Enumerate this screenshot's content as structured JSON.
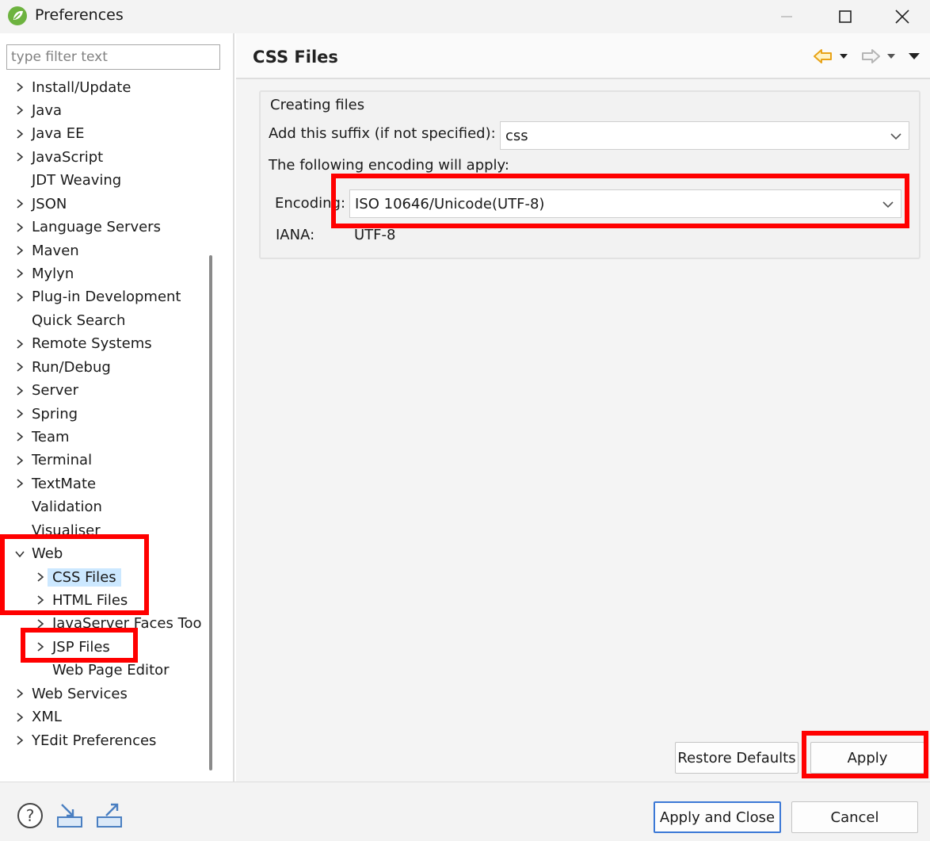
{
  "window": {
    "title": "Preferences",
    "icon": "spring-leaf-icon",
    "controls": [
      "minimize-icon",
      "maximize-icon",
      "close-icon"
    ]
  },
  "filter": {
    "placeholder": "type filter text",
    "value": ""
  },
  "tree": {
    "items": [
      {
        "label": "Install/Update",
        "expandable": true,
        "level": 0
      },
      {
        "label": "Java",
        "expandable": true,
        "level": 0
      },
      {
        "label": "Java EE",
        "expandable": true,
        "level": 0
      },
      {
        "label": "JavaScript",
        "expandable": true,
        "level": 0
      },
      {
        "label": "JDT Weaving",
        "expandable": false,
        "level": 0
      },
      {
        "label": "JSON",
        "expandable": true,
        "level": 0
      },
      {
        "label": "Language Servers",
        "expandable": true,
        "level": 0
      },
      {
        "label": "Maven",
        "expandable": true,
        "level": 0
      },
      {
        "label": "Mylyn",
        "expandable": true,
        "level": 0
      },
      {
        "label": "Plug-in Development",
        "expandable": true,
        "level": 0
      },
      {
        "label": "Quick Search",
        "expandable": false,
        "level": 0
      },
      {
        "label": "Remote Systems",
        "expandable": true,
        "level": 0
      },
      {
        "label": "Run/Debug",
        "expandable": true,
        "level": 0
      },
      {
        "label": "Server",
        "expandable": true,
        "level": 0
      },
      {
        "label": "Spring",
        "expandable": true,
        "level": 0
      },
      {
        "label": "Team",
        "expandable": true,
        "level": 0
      },
      {
        "label": "Terminal",
        "expandable": true,
        "level": 0
      },
      {
        "label": "TextMate",
        "expandable": true,
        "level": 0
      },
      {
        "label": "Validation",
        "expandable": false,
        "level": 0
      },
      {
        "label": "Visualiser",
        "expandable": false,
        "level": 0
      },
      {
        "label": "Web",
        "expandable": true,
        "expanded": true,
        "level": 0
      },
      {
        "label": "CSS Files",
        "expandable": true,
        "level": 1,
        "selected": true
      },
      {
        "label": "HTML Files",
        "expandable": true,
        "level": 1
      },
      {
        "label": "JavaServer Faces Too",
        "expandable": true,
        "level": 1
      },
      {
        "label": "JSP Files",
        "expandable": true,
        "level": 1
      },
      {
        "label": "Web Page Editor",
        "expandable": false,
        "level": 1
      },
      {
        "label": "Web Services",
        "expandable": true,
        "level": 0
      },
      {
        "label": "XML",
        "expandable": true,
        "level": 0
      },
      {
        "label": "YEdit Preferences",
        "expandable": true,
        "level": 0
      }
    ]
  },
  "page": {
    "title": "CSS Files",
    "nav_icons": [
      "back-arrow-icon",
      "dropdown-icon",
      "forward-arrow-icon",
      "dropdown-icon",
      "view-menu-icon"
    ]
  },
  "creating_files": {
    "legend": "Creating files",
    "suffix_label": "Add this suffix (if not specified):",
    "suffix_value": "css",
    "encoding_note": "The following encoding will apply:",
    "encoding_label": "Encoding:",
    "encoding_value": "ISO 10646/Unicode(UTF-8)",
    "iana_label": "IANA:",
    "iana_value": "UTF-8"
  },
  "buttons": {
    "restore_defaults": "Restore Defaults",
    "apply": "Apply",
    "apply_and_close": "Apply and Close",
    "cancel": "Cancel"
  },
  "bottom_icons": [
    "help-icon",
    "import-icon",
    "export-icon"
  ],
  "colors": {
    "highlight_box": "#ff0000",
    "selection": "#cce8ff",
    "default_button_border": "#3b78d6",
    "back_arrow": "#e8a318"
  }
}
